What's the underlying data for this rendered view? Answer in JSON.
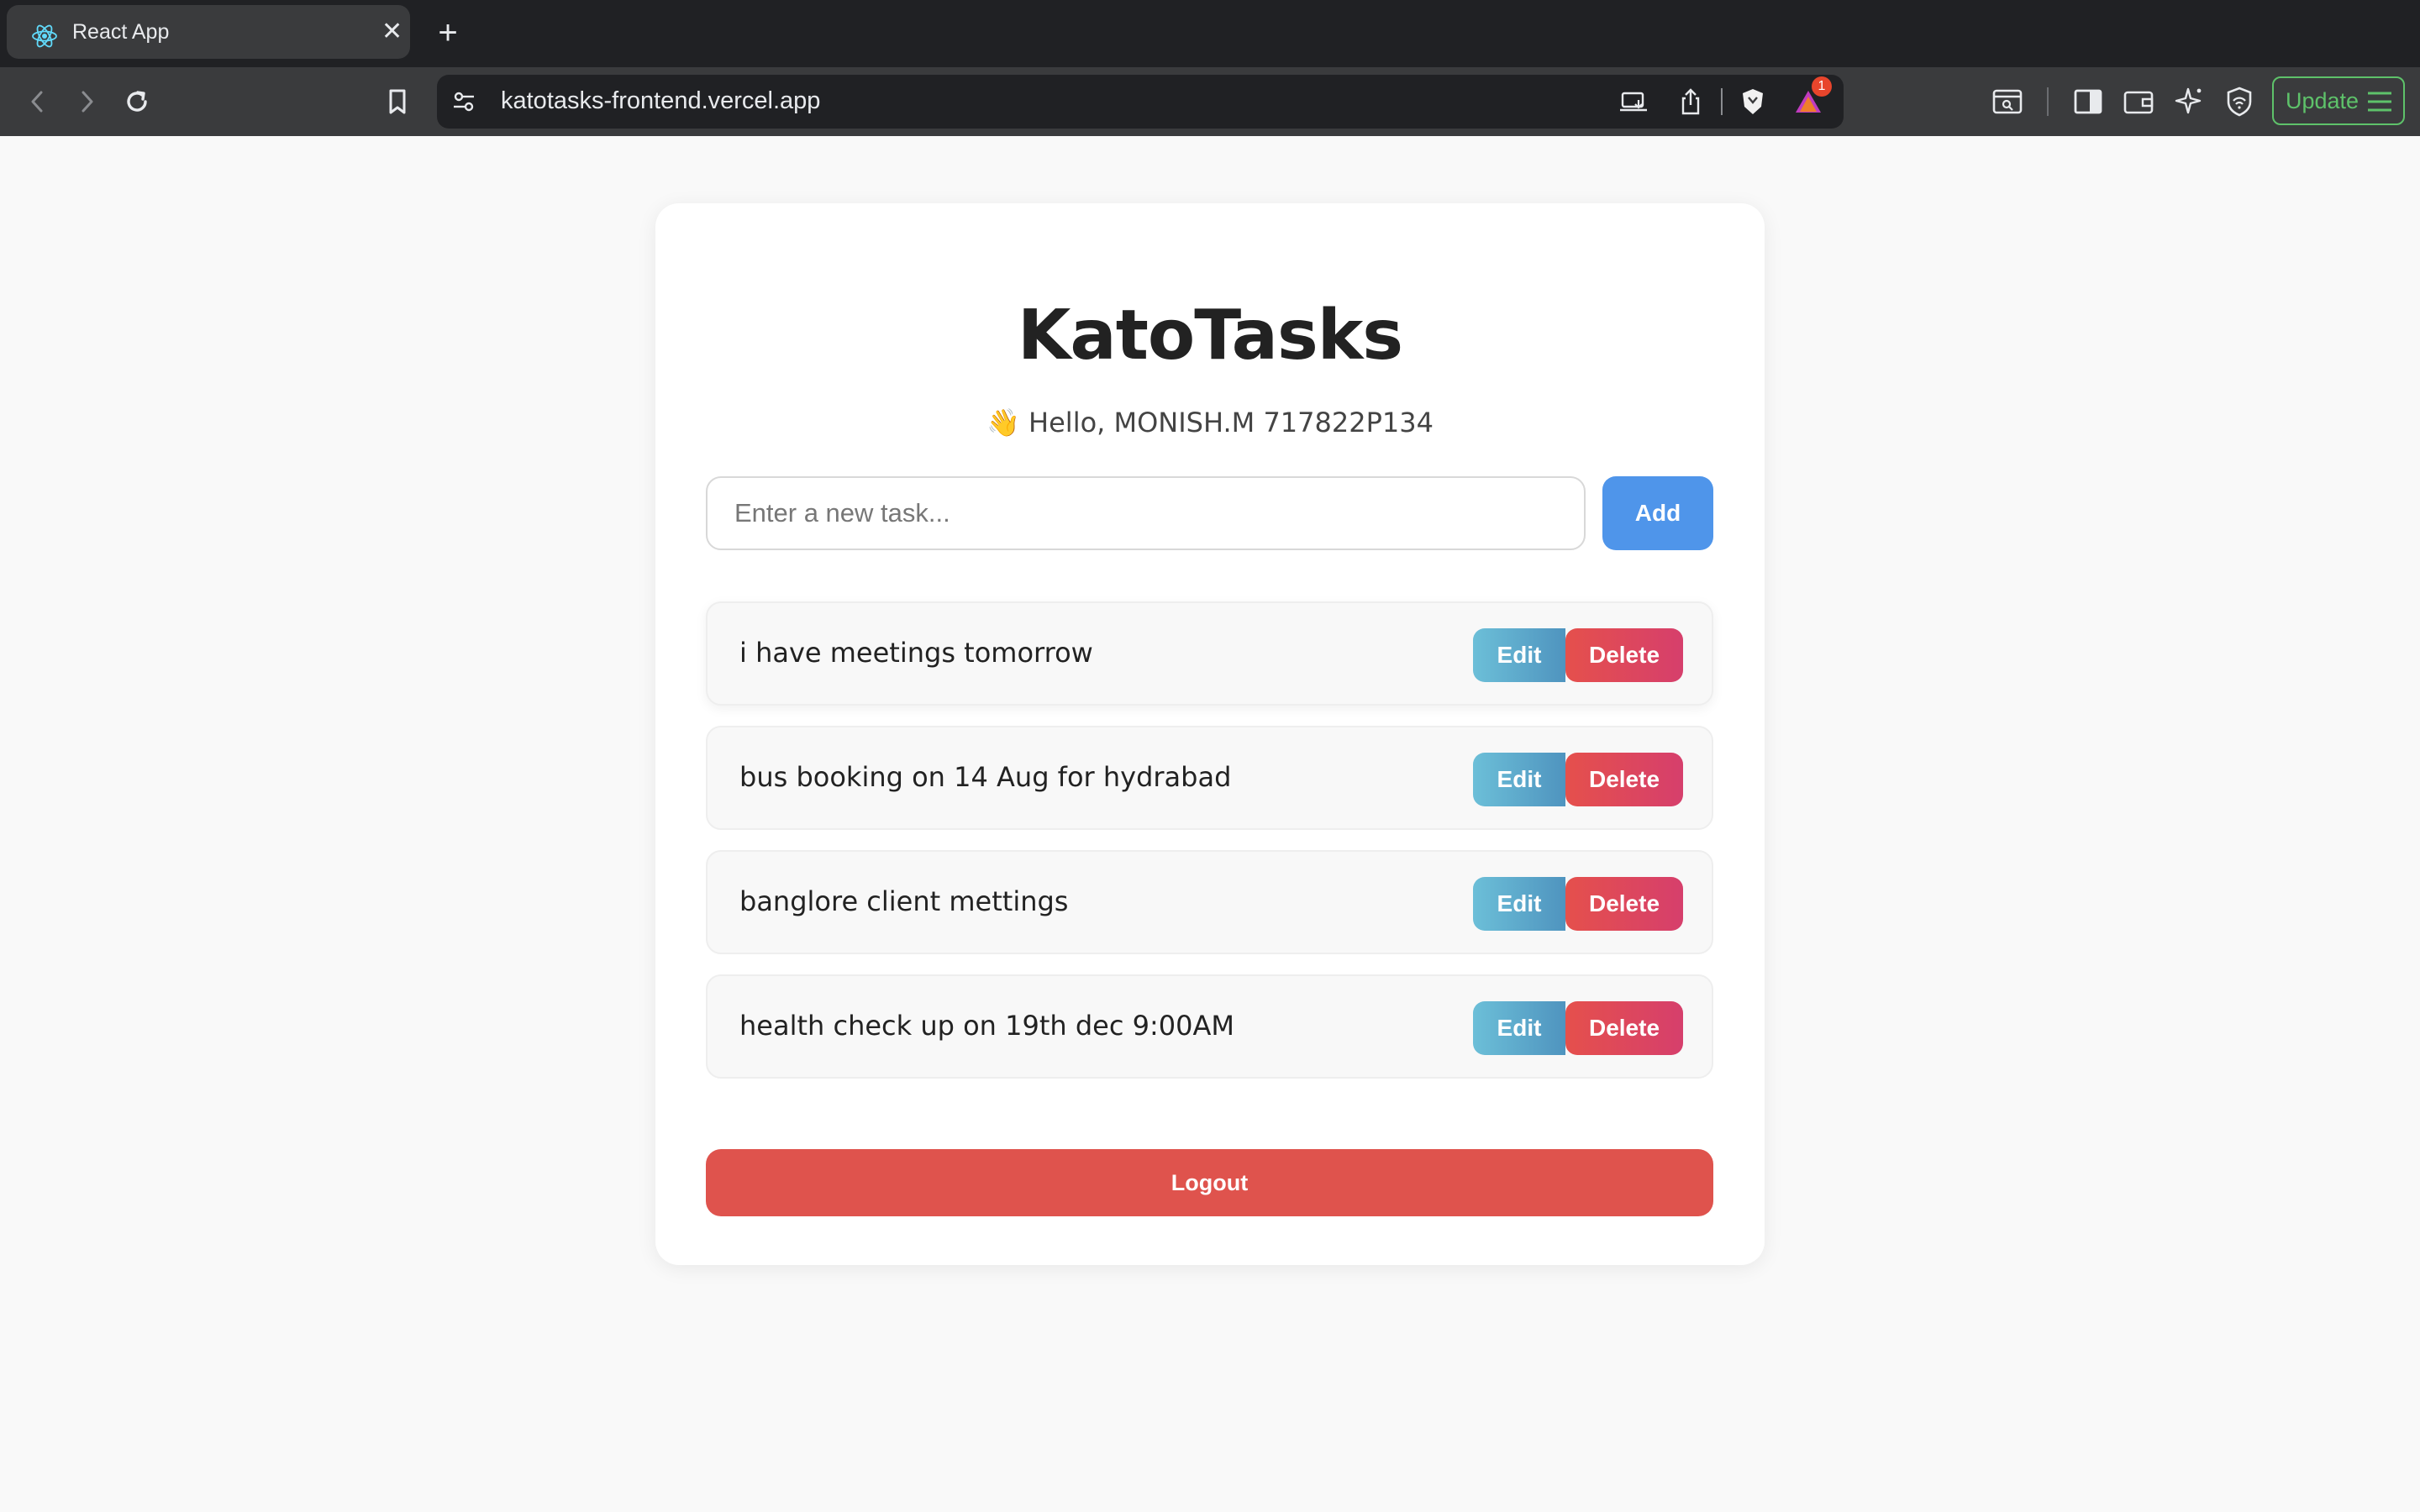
{
  "browser": {
    "tab": {
      "title": "React App",
      "favicon": "react-logo-icon",
      "close_label": "✕"
    },
    "new_tab_label": "+",
    "url": "katotasks-frontend.vercel.app",
    "shields_badge_count": "1",
    "update_label": "Update",
    "icons": [
      "back-icon",
      "forward-icon",
      "reload-icon",
      "bookmark-icon",
      "site-settings-icon",
      "install-app-icon",
      "share-icon",
      "brave-shields-icon",
      "brave-rewards-icon",
      "screenshot-icon",
      "sidebar-icon",
      "wallet-icon",
      "leo-ai-icon",
      "vpn-icon",
      "menu-icon"
    ]
  },
  "app": {
    "title": "KatoTasks",
    "greeting": "👋 Hello, MONISH.M 717822P134",
    "input": {
      "placeholder": "Enter a new task...",
      "value": ""
    },
    "add_label": "Add",
    "edit_label": "Edit",
    "delete_label": "Delete",
    "tasks": [
      {
        "text": "i have meetings tomorrow"
      },
      {
        "text": "bus booking on 14 Aug for hydrabad"
      },
      {
        "text": "banglore client mettings"
      },
      {
        "text": "health check up on 19th dec 9:00AM"
      }
    ],
    "logout_label": "Logout"
  },
  "colors": {
    "primary": "#4f95ea",
    "danger": "#df534d",
    "edit_gradient": [
      "#6cbfd8",
      "#4f94bf"
    ],
    "delete_gradient": [
      "#e5504c",
      "#d63f6c"
    ],
    "update_green": "#5ec26a"
  }
}
